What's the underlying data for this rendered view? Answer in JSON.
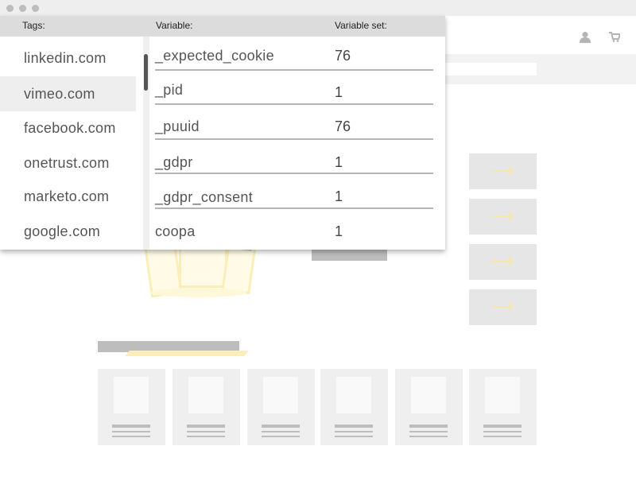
{
  "window": {
    "controls": [
      "close",
      "minimize",
      "maximize"
    ]
  },
  "header": {
    "icons": [
      "user-icon",
      "cart-icon"
    ]
  },
  "panel": {
    "headers": {
      "tags": "Tags:",
      "variable": "Variable:",
      "variable_set": "Variable set:"
    },
    "tags": [
      "linkedin.com",
      "vimeo.com",
      "facebook.com",
      "onetrust.com",
      "marketo.com",
      "google.com"
    ],
    "selected_tag": "vimeo.com",
    "variables": [
      {
        "name": "_expected_cookie",
        "value": "76"
      },
      {
        "name": "_pid",
        "value": "1"
      },
      {
        "name": "_puuid",
        "value": "76"
      },
      {
        "name": "_gdpr",
        "value": "1"
      },
      {
        "name": "_gdpr_consent",
        "value": "1"
      },
      {
        "name": "coopa",
        "value": "1"
      }
    ]
  },
  "colors": {
    "accent_yellow": "#fbeebb",
    "placeholder_gray": "#e6e6e6",
    "header_gray": "#dcdcdc"
  }
}
